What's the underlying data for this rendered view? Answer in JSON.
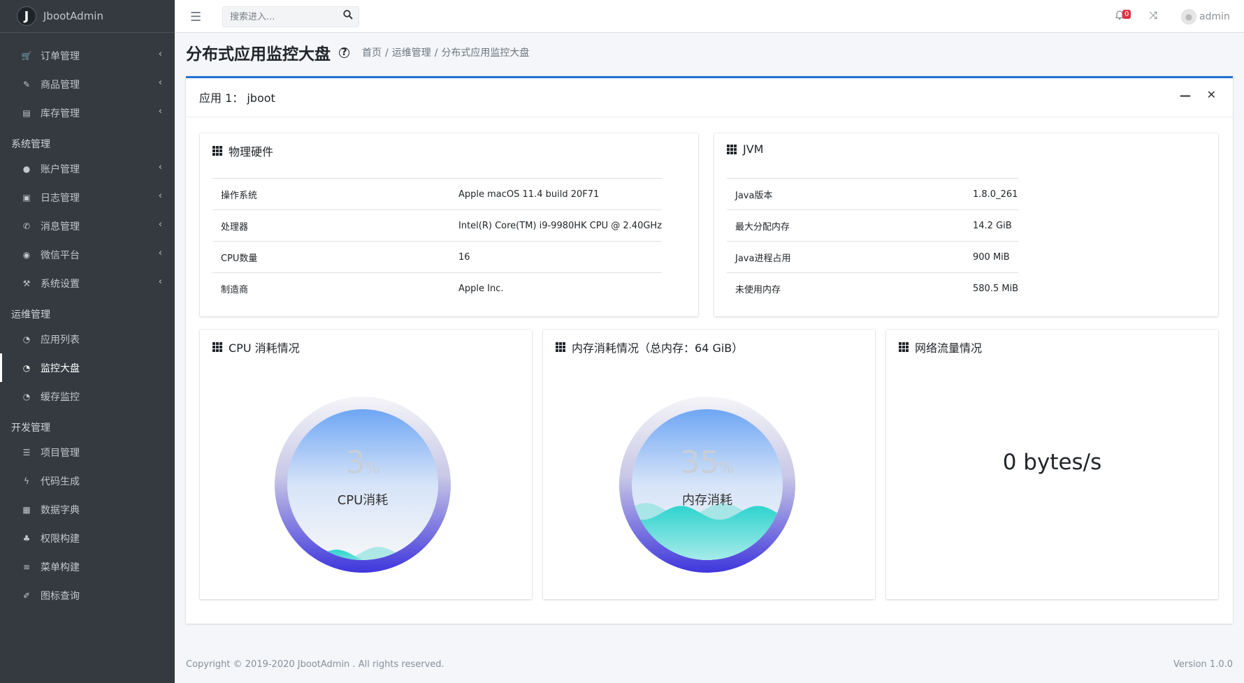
{
  "brand": {
    "logo_letter": "J",
    "name": "JbootAdmin"
  },
  "sidebar": {
    "groups": [
      {
        "header": "",
        "items": [
          {
            "label": "订单管理",
            "icon": "cart-icon",
            "chevron": true
          },
          {
            "label": "商品管理",
            "icon": "paperclip-icon",
            "chevron": true
          },
          {
            "label": "库存管理",
            "icon": "warehouse-icon",
            "chevron": true
          }
        ]
      },
      {
        "header": "系统管理",
        "items": [
          {
            "label": "账户管理",
            "icon": "user-icon",
            "chevron": true
          },
          {
            "label": "日志管理",
            "icon": "book-icon",
            "chevron": true
          },
          {
            "label": "消息管理",
            "icon": "message-icon",
            "chevron": true
          },
          {
            "label": "微信平台",
            "icon": "wechat-icon",
            "chevron": true
          },
          {
            "label": "系统设置",
            "icon": "hammer-icon",
            "chevron": true
          }
        ]
      },
      {
        "header": "运维管理",
        "items": [
          {
            "label": "应用列表",
            "icon": "dashboard-icon",
            "chevron": false
          },
          {
            "label": "监控大盘",
            "icon": "dashboard-icon",
            "chevron": false,
            "active": true
          },
          {
            "label": "缓存监控",
            "icon": "dashboard-icon",
            "chevron": false
          }
        ]
      },
      {
        "header": "开发管理",
        "items": [
          {
            "label": "项目管理",
            "icon": "database-icon",
            "chevron": false
          },
          {
            "label": "代码生成",
            "icon": "bolt-icon",
            "chevron": false
          },
          {
            "label": "数据字典",
            "icon": "grid-icon",
            "chevron": false
          },
          {
            "label": "权限构建",
            "icon": "sitemap-icon",
            "chevron": false
          },
          {
            "label": "菜单构建",
            "icon": "list-icon",
            "chevron": false
          },
          {
            "label": "图标查询",
            "icon": "pen-icon",
            "chevron": false
          }
        ]
      }
    ]
  },
  "topbar": {
    "search_placeholder": "搜索进入...",
    "notification_count": "0",
    "username": "admin"
  },
  "page": {
    "title": "分布式应用监控大盘",
    "breadcrumb": [
      "首页",
      "运维管理",
      "分布式应用监控大盘"
    ]
  },
  "app_card": {
    "title": "应用 1： jboot"
  },
  "hardware": {
    "title": "物理硬件",
    "rows": [
      {
        "key": "操作系统",
        "value": "Apple macOS 11.4 build 20F71"
      },
      {
        "key": "处理器",
        "value": "Intel(R) Core(TM) i9-9980HK CPU @ 2.40GHz"
      },
      {
        "key": "CPU数量",
        "value": "16"
      },
      {
        "key": "制造商",
        "value": "Apple Inc."
      }
    ]
  },
  "jvm": {
    "title": "JVM",
    "rows": [
      {
        "key": "Java版本",
        "value": "1.8.0_261"
      },
      {
        "key": "最大分配内存",
        "value": "14.2 GiB"
      },
      {
        "key": "Java进程占用",
        "value": "900 MiB"
      },
      {
        "key": "未使用内存",
        "value": "580.5 MiB"
      }
    ]
  },
  "cpu": {
    "title": "CPU 消耗情况",
    "percent": 3,
    "percent_text": "3",
    "unit": "%",
    "label": "CPU消耗"
  },
  "memory": {
    "title": "内存消耗情况（总内存：64 GiB）",
    "percent": 35,
    "percent_text": "35",
    "unit": "%",
    "label": "内存消耗"
  },
  "network": {
    "title": "网络流量情况",
    "value": "0 bytes/s"
  },
  "footer": {
    "copyright": "Copyright © 2019-2020 JbootAdmin . All rights reserved.",
    "version": "Version 1.0.0"
  },
  "colors": {
    "accent": "#1f72d4",
    "sidebar_bg": "#343a40",
    "wave": "#2fd4cf",
    "ring": "#4a3fd9"
  }
}
